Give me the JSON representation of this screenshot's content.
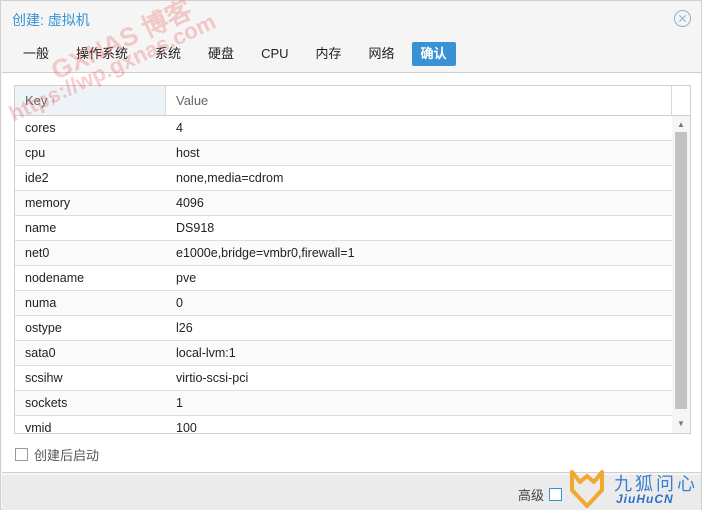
{
  "window": {
    "title": "创建: 虚拟机",
    "close_icon": "close-circle-icon"
  },
  "tabs": [
    {
      "label": "一般",
      "active": false
    },
    {
      "label": "操作系统",
      "active": false
    },
    {
      "label": "系统",
      "active": false
    },
    {
      "label": "硬盘",
      "active": false
    },
    {
      "label": "CPU",
      "active": false
    },
    {
      "label": "内存",
      "active": false
    },
    {
      "label": "网络",
      "active": false
    },
    {
      "label": "确认",
      "active": true
    }
  ],
  "grid": {
    "columns": {
      "key": "Key",
      "key_sort_icon": "↑",
      "value": "Value"
    },
    "rows": [
      {
        "key": "cores",
        "value": "4"
      },
      {
        "key": "cpu",
        "value": "host"
      },
      {
        "key": "ide2",
        "value": "none,media=cdrom"
      },
      {
        "key": "memory",
        "value": "4096"
      },
      {
        "key": "name",
        "value": "DS918"
      },
      {
        "key": "net0",
        "value": "e1000e,bridge=vmbr0,firewall=1"
      },
      {
        "key": "nodename",
        "value": "pve"
      },
      {
        "key": "numa",
        "value": "0"
      },
      {
        "key": "ostype",
        "value": "l26"
      },
      {
        "key": "sata0",
        "value": "local-lvm:1"
      },
      {
        "key": "scsihw",
        "value": "virtio-scsi-pci"
      },
      {
        "key": "sockets",
        "value": "1"
      },
      {
        "key": "vmid",
        "value": "100"
      }
    ]
  },
  "options": {
    "start_after_create_label": "创建后启动",
    "start_after_create_checked": false
  },
  "footer": {
    "advanced_label": "高级",
    "advanced_checked": false
  },
  "watermarks": {
    "overlay_text_1": "GXNAS 博客",
    "overlay_text_2": "https://wp.gxnas.com",
    "logo_cn": "九狐问心",
    "logo_en": "JiuHuCN"
  },
  "colors": {
    "accent": "#3892d4",
    "header_key_bg": "#eef3f8",
    "scroll_thumb": "#c2c2c2"
  }
}
